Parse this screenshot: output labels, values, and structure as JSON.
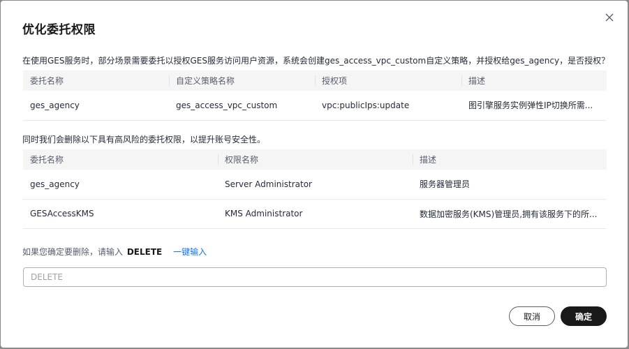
{
  "dialog": {
    "title": "优化委托权限",
    "description": "在使用GES服务时，部分场景需要委托以授权GES服务访问用户资源，系统会创建ges_access_vpc_custom自定义策略，并授权给ges_agency，是否授权？",
    "delete_notice": "同时我们会删除以下具有高风险的委托权限，以提升账号安全性。",
    "confirm_prompt": "如果您确定要删除，请输入",
    "confirm_keyword": "DELETE",
    "quick_fill_link": "一键输入",
    "input": {
      "placeholder": "DELETE",
      "value": ""
    },
    "cancel_label": "取消",
    "ok_label": "确定"
  },
  "table1": {
    "headers": [
      "委托名称",
      "自定义策略名称",
      "授权项",
      "描述"
    ],
    "rows": [
      [
        "ges_agency",
        "ges_access_vpc_custom",
        "vpc:publicIps:update",
        "图引擎服务实例弹性IP切换所需..."
      ]
    ]
  },
  "table2": {
    "headers": [
      "委托名称",
      "权限名称",
      "描述"
    ],
    "rows": [
      [
        "ges_agency",
        "Server Administrator",
        "服务器管理员"
      ],
      [
        "GESAccessKMS",
        "KMS Administrator",
        "数据加密服务(KMS)管理员,拥有该服务下的所..."
      ]
    ]
  },
  "icons": {
    "close": "close-icon"
  },
  "colors": {
    "link": "#1476ff",
    "primary_button": "#191919"
  }
}
